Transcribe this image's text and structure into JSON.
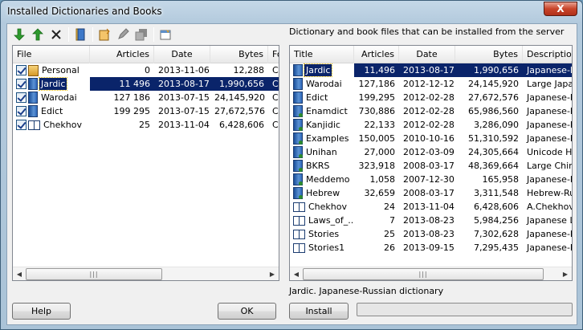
{
  "window": {
    "title": "Installed Dictionaries and Books",
    "close_glyph": "X"
  },
  "toolbar": {
    "icons": [
      "arrow-down-icon",
      "arrow-up-icon",
      "delete-icon",
      "book-properties-icon",
      "new-dictionary-icon",
      "edit-icon",
      "copy-icon",
      "settings-icon"
    ]
  },
  "server_caption": "Dictionary and book files that can be installed from the server",
  "installed": {
    "columns": [
      "File",
      "Articles",
      "Date",
      "Bytes",
      "Fo"
    ],
    "rows": [
      {
        "name": "Personal",
        "articles": "0",
        "date": "2013-11-06",
        "bytes": "12,288",
        "folder": "C:",
        "checked": true,
        "icon": "personal-icon",
        "selected": false
      },
      {
        "name": "Jardic",
        "articles": "11 496",
        "date": "2013-08-17",
        "bytes": "1,990,656",
        "folder": "C:",
        "checked": true,
        "icon": "dictionary-icon",
        "selected": true
      },
      {
        "name": "Warodai",
        "articles": "127 186",
        "date": "2013-07-15",
        "bytes": "24,145,920",
        "folder": "C:",
        "checked": true,
        "icon": "dictionary-icon",
        "selected": false
      },
      {
        "name": "Edict",
        "articles": "199 295",
        "date": "2013-07-15",
        "bytes": "27,672,576",
        "folder": "C:",
        "checked": true,
        "icon": "dictionary-icon",
        "selected": false
      },
      {
        "name": "Chekhov",
        "articles": "25",
        "date": "2013-11-04",
        "bytes": "6,428,606",
        "folder": "C:",
        "checked": true,
        "icon": "book-icon",
        "selected": false
      }
    ],
    "scroll_thumb_glyph": "|||"
  },
  "server": {
    "columns": [
      "Title",
      "Articles",
      "Date",
      "Bytes",
      "Description"
    ],
    "rows": [
      {
        "name": "Jardic",
        "articles": "11,496",
        "date": "2013-08-17",
        "bytes": "1,990,656",
        "desc": "Japanese-F",
        "icon": "dictionary-icon",
        "selected": true
      },
      {
        "name": "Warodai",
        "articles": "127,186",
        "date": "2012-12-12",
        "bytes": "24,145,920",
        "desc": "Large Japa",
        "icon": "dictionary-icon",
        "selected": false
      },
      {
        "name": "Edict",
        "articles": "199,295",
        "date": "2012-02-28",
        "bytes": "27,672,576",
        "desc": "Japanese-E",
        "icon": "dictionary-icon",
        "selected": false
      },
      {
        "name": "Enamdict",
        "articles": "730,886",
        "date": "2012-02-28",
        "bytes": "65,986,560",
        "desc": "Japanese-E",
        "icon": "dictionary-download-icon",
        "selected": false
      },
      {
        "name": "Kanjidic",
        "articles": "22,133",
        "date": "2012-02-28",
        "bytes": "3,286,090",
        "desc": "Japanese-E",
        "icon": "dictionary-download-icon",
        "selected": false
      },
      {
        "name": "Examples",
        "articles": "150,005",
        "date": "2010-10-16",
        "bytes": "51,310,592",
        "desc": "Japanese-E",
        "icon": "dictionary-download-icon",
        "selected": false
      },
      {
        "name": "Unihan",
        "articles": "27,000",
        "date": "2012-03-09",
        "bytes": "24,305,664",
        "desc": "Unicode H",
        "icon": "dictionary-download-icon",
        "selected": false
      },
      {
        "name": "BKRS",
        "articles": "323,918",
        "date": "2008-03-17",
        "bytes": "48,369,664",
        "desc": "Large Chin",
        "icon": "dictionary-download-icon",
        "selected": false
      },
      {
        "name": "Meddemo",
        "articles": "1,058",
        "date": "2007-12-30",
        "bytes": "165,958",
        "desc": "Japanese-F",
        "icon": "dictionary-download-icon",
        "selected": false
      },
      {
        "name": "Hebrew",
        "articles": "32,659",
        "date": "2008-03-17",
        "bytes": "3,311,548",
        "desc": "Hebrew-Ru",
        "icon": "dictionary-download-icon",
        "selected": false
      },
      {
        "name": "Chekhov",
        "articles": "24",
        "date": "2013-11-04",
        "bytes": "6,428,606",
        "desc": "A.Chekhov",
        "icon": "book-icon",
        "selected": false
      },
      {
        "name": "Laws_of_...",
        "articles": "7",
        "date": "2013-08-23",
        "bytes": "5,984,256",
        "desc": "Japanese L",
        "icon": "book-icon",
        "selected": false
      },
      {
        "name": "Stories",
        "articles": "25",
        "date": "2013-08-23",
        "bytes": "7,302,628",
        "desc": "Japanese-E",
        "icon": "book-icon",
        "selected": false
      },
      {
        "name": "Stories1",
        "articles": "26",
        "date": "2013-09-15",
        "bytes": "7,295,435",
        "desc": "Japanese-E",
        "icon": "book-icon",
        "selected": false
      }
    ],
    "scroll_thumb_glyph": "|||"
  },
  "description": "Jardic. Japanese-Russian dictionary",
  "buttons": {
    "help": "Help",
    "ok": "OK",
    "install": "Install"
  },
  "progress": {
    "fraction": 0
  },
  "colors": {
    "selection": "#0a246a",
    "window_frame": "#b3cadd"
  }
}
